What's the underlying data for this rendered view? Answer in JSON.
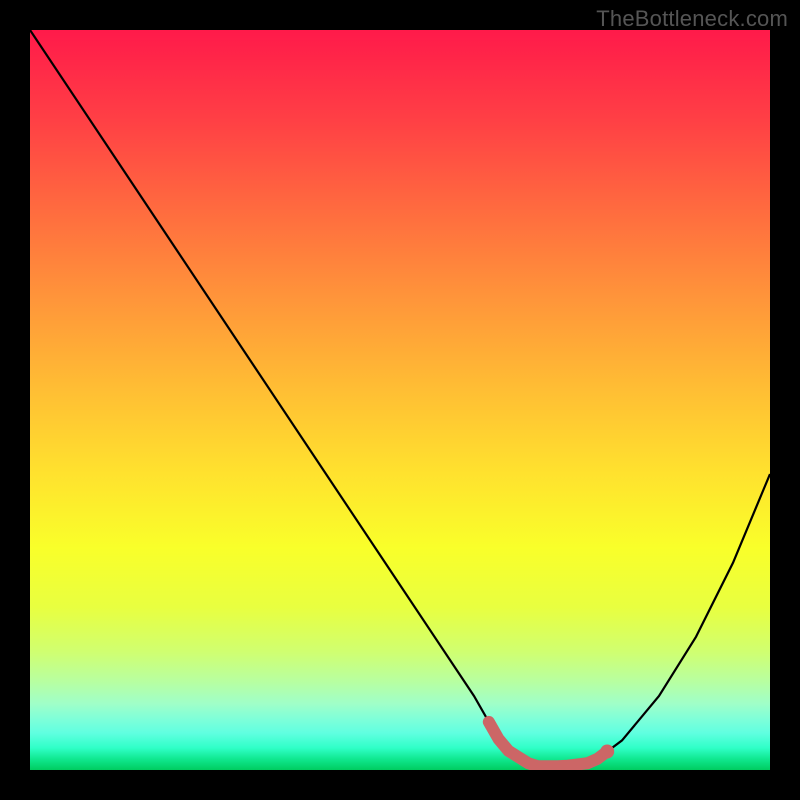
{
  "watermark": "TheBottleneck.com",
  "chart_data": {
    "type": "line",
    "title": "",
    "xlabel": "",
    "ylabel": "",
    "xlim": [
      0,
      100
    ],
    "ylim": [
      0,
      100
    ],
    "series": [
      {
        "name": "curve",
        "color": "#000000",
        "x": [
          0,
          10,
          20,
          30,
          40,
          50,
          60,
          64,
          68,
          72,
          76,
          80,
          85,
          90,
          95,
          100
        ],
        "y": [
          100,
          85,
          70,
          55,
          40,
          25,
          10,
          3,
          0.5,
          0.5,
          1,
          4,
          10,
          18,
          28,
          40
        ]
      }
    ],
    "highlight_band": {
      "color": "#cc6666",
      "x_range": [
        62,
        78
      ],
      "thickness": 12
    },
    "gradient_stops": [
      {
        "pos": 0,
        "color": "#ff1a4a"
      },
      {
        "pos": 50,
        "color": "#ffe000"
      },
      {
        "pos": 100,
        "color": "#00cc60"
      }
    ]
  }
}
